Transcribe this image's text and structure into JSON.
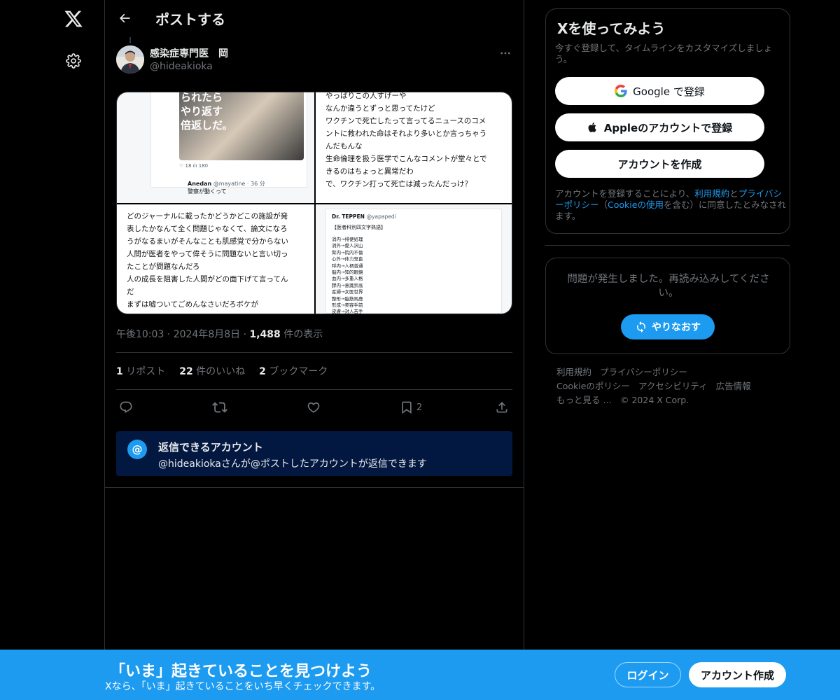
{
  "nav": {
    "logo_icon": "x-logo-icon",
    "settings_icon": "gear-icon"
  },
  "header": {
    "title": "ポストする",
    "back_icon": "arrow-left-icon"
  },
  "post": {
    "author_name": "感染症専門医　岡",
    "author_handle": "@hideakioka",
    "timestamp": "午後10:03 · 2024年8月8日",
    "views_count": "1,488",
    "views_label": " 件の表示",
    "stats": {
      "reposts_count": "1",
      "reposts_label": "リポスト",
      "likes_count": "22",
      "likes_label": "件のいいね",
      "bookmarks_count": "2",
      "bookmarks_label": "ブックマーク"
    },
    "action_bookmark_count": "2",
    "media": {
      "top_left": {
        "kanji": "られたら\nやり返す\n倍返しだ。",
        "actions": "♡ 18   ılı 180",
        "reply_name": "Anedan",
        "reply_handle": "@mayatine · 36 分",
        "reply_text": "警察が動くって"
      },
      "top_right": {
        "lines": [
          "やっぱりこの人すげーや",
          "なんか違うとずっと思ってたけど",
          "ワクチンで死亡したって言ってるニュースのコメ",
          "ントに救われた命はそれより多いとか言っちゃう",
          "んだもんな",
          "生命倫理を扱う医学でこんなコメントが堂々とで",
          "きるのはちょっと異常だわ",
          "で、ワクチン打って死亡は減ったんだっけ？"
        ]
      },
      "bottom_left": {
        "lines": [
          "どのジャーナルに載ったかどうかどこの施設が発",
          "表したかなんて全く問題じゃなくて、論文になろ",
          "うがなるまいがそんなことも肌感覚で分からない",
          "人間が医者をやって偉そうに問題ないと言い切っ",
          "たことが問題なんだろ",
          "人の成長を阻害した人間がどの面下げて言ってん",
          "だ",
          "まずは嘘ついてごめんなさいだろボケが"
        ]
      },
      "bottom_right": {
        "name": "Dr. TEPPEN",
        "handle": "@yapapedi",
        "title": "【医者科別四文字熟語】",
        "items": "消内→排便処理\n消外→愛人沢山\n腎内→院内不倫\n心外→体力鬼畜\n呼内→人柄普通\n脳内→知的眼鏡\n血内→多重人格\n膠内→意識崇高\n産婦→女医世界\n整形→脳筋馬鹿\n形成→美容手前\n皮膚→対人苦手"
      }
    }
  },
  "reply_notice": {
    "title": "返信できるアカウント",
    "desc": "@hideakiokaさんが@ポストしたアカウントが返信できます",
    "icon": "@"
  },
  "signup": {
    "title": "Xを使ってみよう",
    "subtitle": "今すぐ登録して、タイムラインをカスタマイズしましょう。",
    "google_label": "Google で登録",
    "apple_label": "Appleのアカウントで登録",
    "create_label": "アカウントを作成",
    "terms_pre": "アカウントを登録することにより、",
    "terms_link1": "利用規約",
    "terms_and": "と",
    "terms_link2": "プライバシーポリシー",
    "terms_paren_open": "（",
    "terms_link3": "Cookieの使用",
    "terms_post": "を含む）に同意したとみなされます。"
  },
  "error": {
    "message": "問題が発生しました。再読み込みしてください。",
    "retry_label": "やりなおす"
  },
  "footer": {
    "links": [
      "利用規約",
      "プライバシーポリシー",
      "Cookieのポリシー",
      "アクセシビリティ",
      "広告情報",
      "もっと見る …",
      "© 2024 X Corp."
    ]
  },
  "bottom_bar": {
    "title": "「いま」起きていることを見つけよう",
    "subtitle": "Xなら、「いま」起きていることをいち早くチェックできます。",
    "login_label": "ログイン",
    "signup_label": "アカウント作成"
  },
  "colors": {
    "accent": "#1d9bf0",
    "background": "#000000",
    "border": "#2f3336",
    "muted": "#71767b",
    "notice_bg": "#031840"
  }
}
